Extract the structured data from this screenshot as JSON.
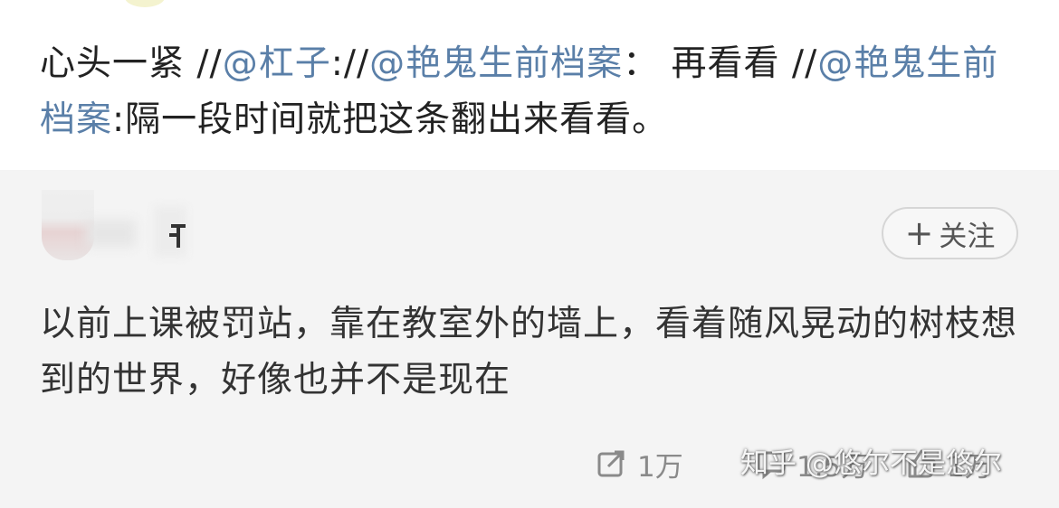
{
  "repost": {
    "segments": [
      {
        "text": "心头一紧 //",
        "type": "text"
      },
      {
        "text": "@杠子",
        "type": "mention"
      },
      {
        "text": "://",
        "type": "text"
      },
      {
        "text": "@艳鬼生前档案",
        "type": "mention"
      },
      {
        "text": "： 再看看 //",
        "type": "text"
      },
      {
        "text": "@艳鬼生前档案",
        "type": "mention"
      },
      {
        "text": ":隔一段时间就把这条翻出来看看。",
        "type": "text"
      }
    ]
  },
  "comment": {
    "follow_label": "关注",
    "follow_icon": "plus-icon",
    "body": "以前上课被罚站，靠在教室外的墙上，看着随风晃动的树枝想到的世界，好像也并不是现在",
    "actions": {
      "repost_count": "1万",
      "comment_count": "1.5万",
      "like_count": "1万"
    }
  },
  "watermark": "知乎 @悠尔不是悠尔",
  "colors": {
    "mention": "#5a7fa8",
    "card_bg": "#f4f4f4",
    "text": "#222222",
    "muted": "#8a8a8a"
  }
}
